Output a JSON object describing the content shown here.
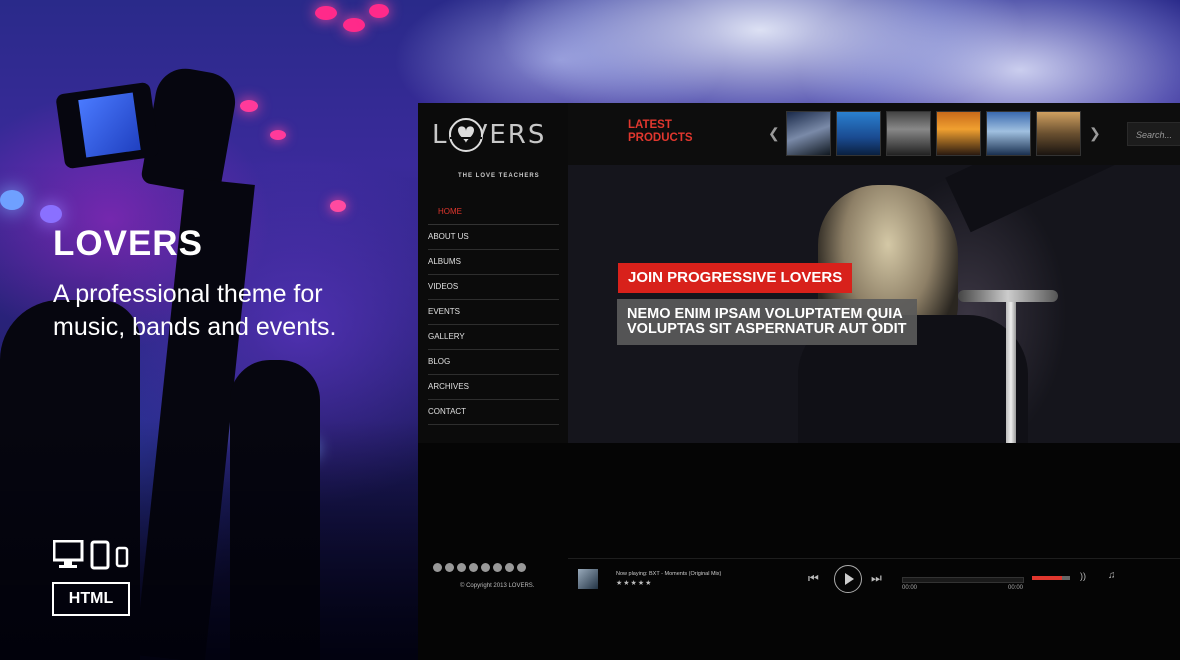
{
  "promo": {
    "title": "LOVERS",
    "tagline": "A professional theme for music, bands and events.",
    "badge": "HTML",
    "device_icons": [
      "desktop-icon",
      "tablet-icon",
      "phone-icon"
    ]
  },
  "site": {
    "logo_text": "LOVERS",
    "logo_subtitle": "THE LOVE TEACHERS",
    "nav": [
      "HOME",
      "ABOUT US",
      "ALBUMS",
      "VIDEOS",
      "EVENTS",
      "GALLERY",
      "BLOG",
      "ARCHIVES",
      "CONTACT"
    ],
    "latest_products_label": "LATEST\nPRODUCTS",
    "search_placeholder": "Search...",
    "hero": {
      "badge": "JOIN PROGRESSIVE LOVERS",
      "text": "NEMO ENIM IPSAM VOLUPTATEM QUIA VOLUPTAS SIT ASPERNATUR AUT ODIT"
    },
    "footer": {
      "social_icons": [
        "twitter-icon",
        "facebook-icon",
        "google-plus-icon",
        "youtube-icon",
        "vimeo-icon",
        "soundcloud-icon",
        "instagram-icon",
        "rss-icon"
      ],
      "copyright": "© Copyright 2013 LOVERS."
    },
    "player": {
      "now_playing": "Now playing: BXT - Moments (Original Mix)",
      "rating": "★★★★★",
      "time_start": "00:00",
      "time_end": "00:00",
      "volume": 0.8
    }
  },
  "colors": {
    "accent": "#e1372e",
    "hero_badge": "#d8211b",
    "panel": "#0d0d0d"
  }
}
